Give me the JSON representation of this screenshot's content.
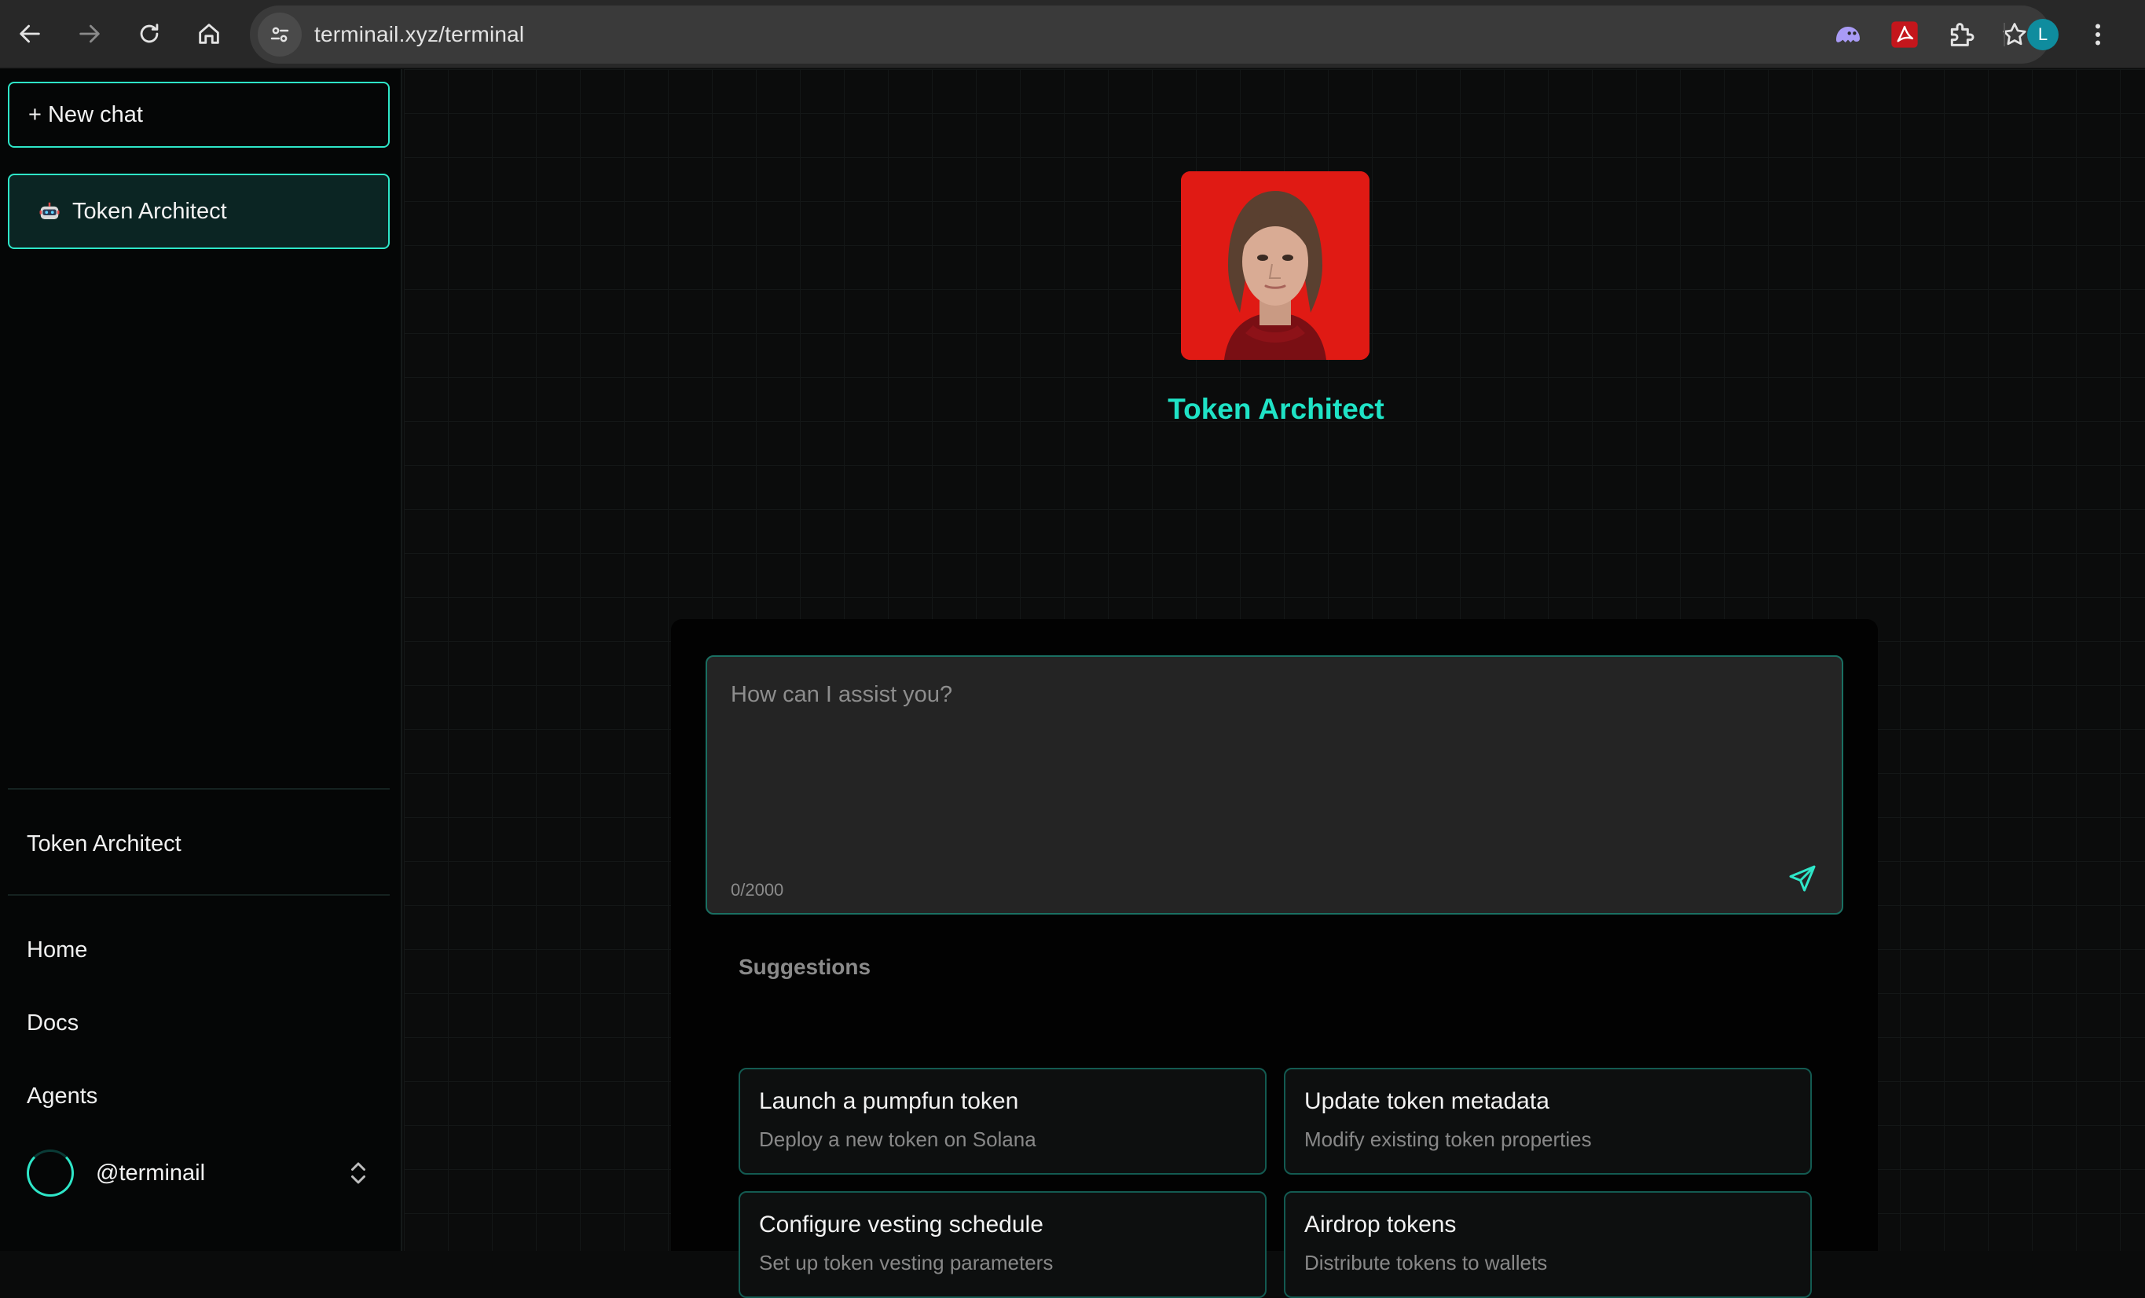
{
  "browser": {
    "url": "terminail.xyz/terminal",
    "profile_initial": "L",
    "accent_colors": {
      "profile": "#0f8c9e"
    }
  },
  "sidebar": {
    "new_chat_label": "+ New chat",
    "chats": [
      {
        "label": "Token Architect",
        "icon": "robot-icon"
      }
    ],
    "section_label": "Token Architect",
    "nav": [
      {
        "label": "Home"
      },
      {
        "label": "Docs"
      },
      {
        "label": "Agents"
      }
    ],
    "user": {
      "handle": "@terminail"
    }
  },
  "main": {
    "agent_name": "Token Architect",
    "input": {
      "placeholder": "How can I assist you?",
      "value": "",
      "counter": "0/2000"
    },
    "suggestions_title": "Suggestions",
    "suggestions": [
      {
        "title": "Launch a pumpfun token",
        "subtitle": "Deploy a new token on Solana"
      },
      {
        "title": "Update token metadata",
        "subtitle": "Modify existing token properties"
      },
      {
        "title": "Configure vesting schedule",
        "subtitle": "Set up token vesting parameters"
      },
      {
        "title": "Airdrop tokens",
        "subtitle": "Distribute tokens to wallets"
      }
    ]
  },
  "colors": {
    "accent": "#2ee6c8",
    "agent_name": "#1fe3c6",
    "photo_background": "#e01a14"
  }
}
